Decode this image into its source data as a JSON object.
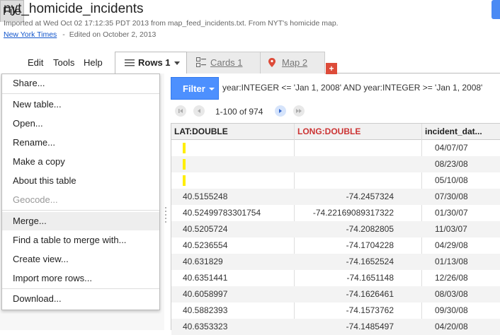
{
  "header": {
    "title": "nyt_homicide_incidents",
    "subtitle": "Imported at Wed Oct 02 17:12:35 PDT 2013 from map_feed_incidents.txt. From NYT's homicide map.",
    "owner_link": "New York Times",
    "separator": "-",
    "edited": "Edited on October 2, 2013"
  },
  "menubar": {
    "file": "File",
    "edit": "Edit",
    "tools": "Tools",
    "help": "Help"
  },
  "tabs": {
    "rows": "Rows 1",
    "cards": "Cards 1",
    "map": "Map 2",
    "add": "+"
  },
  "filter": {
    "button_label": "Filter",
    "expression": "year:INTEGER <= 'Jan 1, 2008' AND year:INTEGER >= 'Jan 1, 2008'"
  },
  "pager": {
    "range_text": "1-100 of 974"
  },
  "table": {
    "columns": [
      {
        "label": "LAT:DOUBLE",
        "color": "#222222"
      },
      {
        "label": "LONG:DOUBLE",
        "color": "#cc3333"
      },
      {
        "label": "incident_dat...",
        "color": "#222222"
      }
    ],
    "rows": [
      {
        "lat": "",
        "long": "",
        "date": "04/07/07",
        "marker": true
      },
      {
        "lat": "",
        "long": "",
        "date": "08/23/08",
        "marker": true
      },
      {
        "lat": "",
        "long": "",
        "date": "05/10/08",
        "marker": true
      },
      {
        "lat": "40.5155248",
        "long": "-74.2457324",
        "date": "07/30/08",
        "marker": false
      },
      {
        "lat": "40.52499783301754",
        "long": "-74.22169089317322",
        "date": "01/30/07",
        "marker": false
      },
      {
        "lat": "40.5205724",
        "long": "-74.2082805",
        "date": "11/03/07",
        "marker": false
      },
      {
        "lat": "40.5236554",
        "long": "-74.1704228",
        "date": "04/29/08",
        "marker": false
      },
      {
        "lat": "40.631829",
        "long": "-74.1652524",
        "date": "01/13/08",
        "marker": false
      },
      {
        "lat": "40.6351441",
        "long": "-74.1651148",
        "date": "12/26/08",
        "marker": false
      },
      {
        "lat": "40.6058997",
        "long": "-74.1626461",
        "date": "08/03/08",
        "marker": false
      },
      {
        "lat": "40.5882393",
        "long": "-74.1573762",
        "date": "09/30/08",
        "marker": false
      },
      {
        "lat": "40.6353323",
        "long": "-74.1485497",
        "date": "04/20/08",
        "marker": false
      }
    ]
  },
  "file_menu": {
    "share": "Share...",
    "new_table": "New table...",
    "open": "Open...",
    "rename": "Rename...",
    "make_copy": "Make a copy",
    "about": "About this table",
    "geocode": "Geocode...",
    "merge": "Merge...",
    "find_table": "Find a table to merge with...",
    "create_view": "Create view...",
    "import_rows": "Import more rows...",
    "download": "Download..."
  },
  "colors": {
    "accent": "#4d90fe",
    "location_marker": "#ffee00",
    "add_tab": "#dd4b39"
  }
}
